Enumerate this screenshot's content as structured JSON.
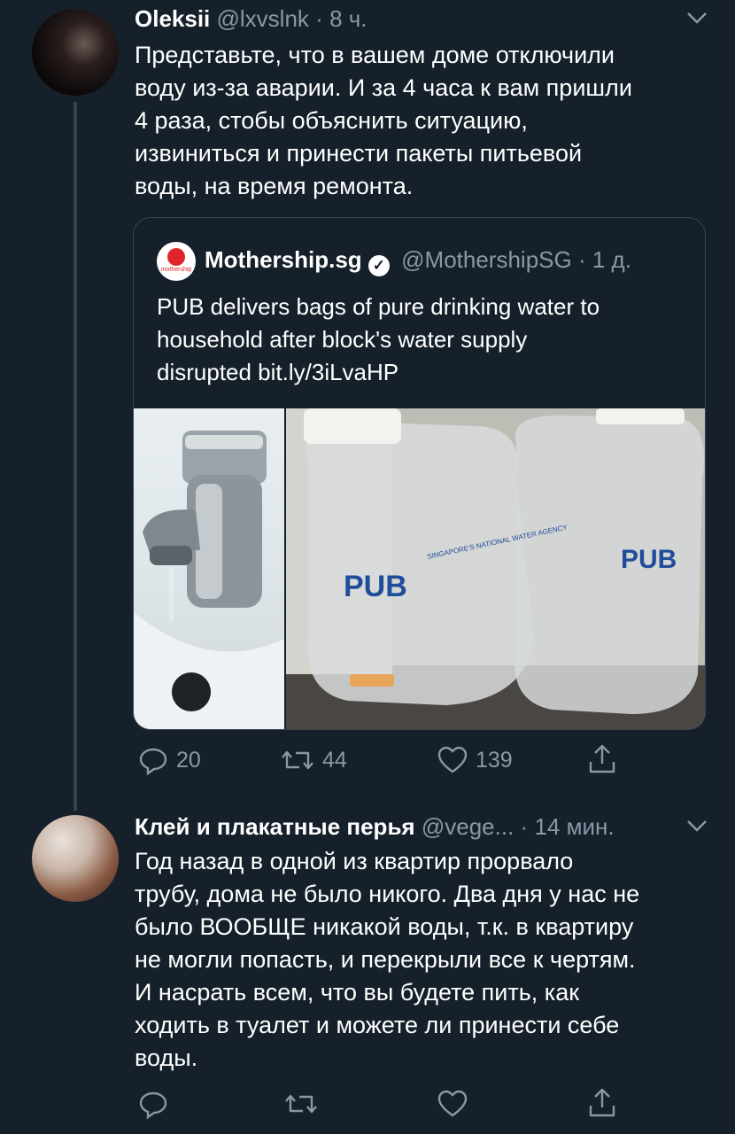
{
  "tweet1": {
    "name": "Oleksii",
    "handle": "@lxvslnk",
    "separator": "·",
    "time": "8 ч.",
    "lines": [
      "Представьте, что в вашем доме отключили",
      "воду из-за аварии. И за 4 часа к вам пришли",
      "4 раза, стобы объяснить ситуацию,",
      "извиниться и принести пакеты питьевой",
      "воды, на время ремонта."
    ],
    "quote": {
      "logo_text": "mothership",
      "name": "Mothership.sg",
      "handle": "@MothershipSG",
      "separator": "·",
      "time": "1 д.",
      "lines": [
        "PUB delivers bags of pure drinking water to",
        "household after block's water supply",
        "disrupted bit.ly/3iLvaHP"
      ],
      "bag_label_left": "PUB",
      "bag_label_right": "PUB",
      "bag_small_text": "SINGAPORE'S NATIONAL WATER AGENCY"
    },
    "actions": {
      "replies": "20",
      "retweets": "44",
      "likes": "139"
    }
  },
  "tweet2": {
    "name": "Клей и плакатные перья",
    "handle": "@vege...",
    "separator": "·",
    "time": "14 мин.",
    "lines": [
      "Год назад в одной из квартир прорвало",
      "трубу, дома не было никого. Два дня у нас не",
      "было ВООБЩЕ никакой воды, т.к. в квартиру",
      "не могли попасть, и перекрыли все к чертям.",
      "И насрать всем, что вы будете пить, как",
      "ходить в туалет и можете ли принести себе",
      "воды."
    ]
  },
  "icons": [
    "chevron-down-icon",
    "verified-icon",
    "reply-icon",
    "retweet-icon",
    "like-icon",
    "share-icon"
  ],
  "colors": {
    "background": "#15202b",
    "muted": "#8899a6",
    "border": "#38444d"
  }
}
